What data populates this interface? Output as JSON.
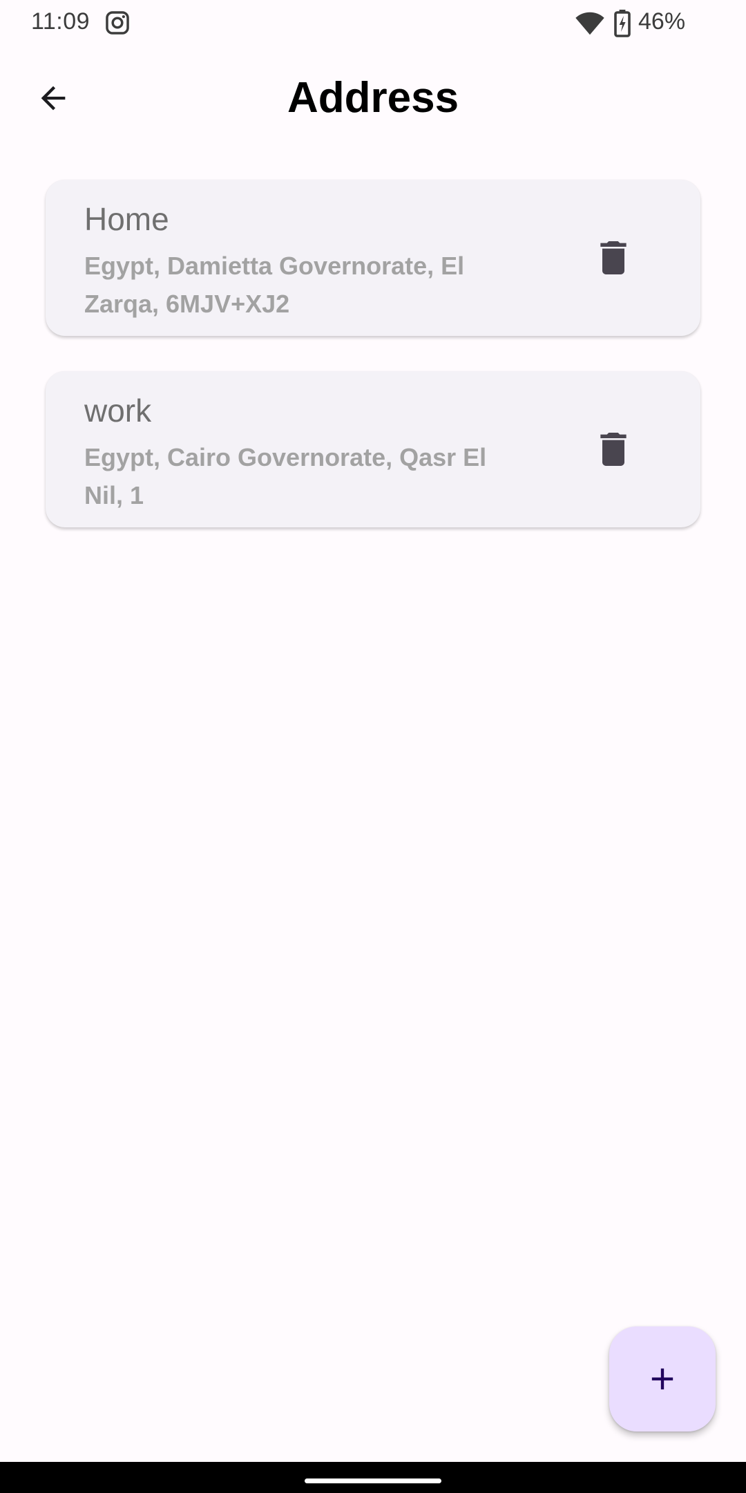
{
  "status_bar": {
    "time": "11:09",
    "battery": "46%",
    "icons": [
      "instagram-icon",
      "wifi-icon",
      "battery-charging-icon"
    ]
  },
  "app_bar": {
    "title": "Address",
    "back_icon": "arrow-back-icon"
  },
  "addresses": [
    {
      "title": "Home",
      "address": "Egypt, Damietta Governorate, El Zarqa, 6MJV+XJ2",
      "delete_icon": "trash-icon"
    },
    {
      "title": "work",
      "address": "Egypt, Cairo Governorate, Qasr El Nil, 1",
      "delete_icon": "trash-icon"
    }
  ],
  "fab": {
    "icon": "plus-icon"
  },
  "colors": {
    "background": "#fffbfe",
    "card": "#f4f2f7",
    "fab": "#eaddff",
    "fab_icon": "#21005d",
    "title_text": "#6f6f6f",
    "address_text": "#a2a2a2",
    "icon": "#49454f"
  }
}
